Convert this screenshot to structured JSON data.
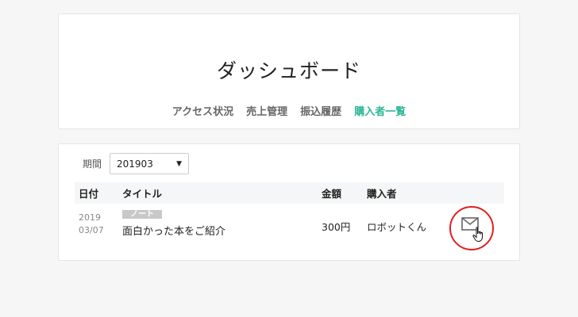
{
  "header": {
    "title": "ダッシュボード",
    "tabs": [
      {
        "label": "アクセス状況"
      },
      {
        "label": "売上管理"
      },
      {
        "label": "振込履歴"
      },
      {
        "label": "購入者一覧",
        "active": true
      }
    ]
  },
  "filter": {
    "label": "期間",
    "selected": "201903"
  },
  "table": {
    "columns": [
      "日付",
      "タイトル",
      "金額",
      "購入者"
    ],
    "rows": [
      {
        "date_year": "2019",
        "date_day": "03/07",
        "tag": "ノート",
        "title": "面白かった本をご紹介",
        "amount": "300円",
        "buyer": "ロボットくん"
      }
    ]
  },
  "colors": {
    "accent": "#2cb696",
    "highlight": "#e02020"
  },
  "icons": [
    "mail-icon",
    "hand-cursor-icon",
    "caret-down-icon"
  ]
}
